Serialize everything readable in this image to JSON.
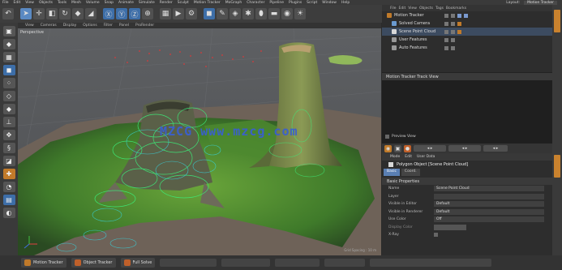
{
  "menubar": {
    "items": [
      "File",
      "Edit",
      "View",
      "Objects",
      "Tools",
      "Mesh",
      "Volume",
      "Snap",
      "Animate",
      "Simulate",
      "Render",
      "Sculpt",
      "Motion Tracker",
      "MoGraph",
      "Character",
      "Pipeline",
      "Plugins",
      "Script",
      "Window",
      "Help"
    ],
    "layout_label": "Layout:",
    "layout_value": "Motion Tracker"
  },
  "viewport": {
    "menu": [
      "View",
      "Cameras",
      "Display",
      "Options",
      "Filter",
      "Panel",
      "ProRender"
    ],
    "label": "Perspective",
    "watermark": "MZCG www.mzcg.com",
    "corner_text": "Grid Spacing : 10 m"
  },
  "object_manager": {
    "menu": [
      "File",
      "Edit",
      "View",
      "Objects",
      "Tags",
      "Bookmarks"
    ],
    "objects": [
      {
        "name": "Motion Tracker",
        "color": "#c07a2a"
      },
      {
        "name": "Solved Camera",
        "color": "#6a9ad0"
      },
      {
        "name": "Scene Point Cloud",
        "color": "#d8d8d8"
      },
      {
        "name": "User Features",
        "color": "#d8d8d8"
      },
      {
        "name": "Auto Features",
        "color": "#d8d8d8"
      }
    ]
  },
  "track_view": {
    "title": "Motion Tracker Track View",
    "preview_label": "Preview View"
  },
  "attributes": {
    "menu": [
      "Mode",
      "Edit",
      "User Data"
    ],
    "title": "Polygon Object [Scene Point Cloud]",
    "tabs": [
      "Basic",
      "Coord."
    ],
    "section": "Basic Properties",
    "props": [
      {
        "k": "Name",
        "v": "Scene Point Cloud"
      },
      {
        "k": "Layer",
        "v": ""
      },
      {
        "k": "Visible in Editor",
        "v": "Default"
      },
      {
        "k": "Visible in Renderer",
        "v": "Default"
      },
      {
        "k": "Use Color",
        "v": "Off"
      },
      {
        "k": "Display Color",
        "v": ""
      },
      {
        "k": "X-Ray",
        "v": ""
      }
    ]
  },
  "status": {
    "buttons": [
      {
        "label": "Motion Tracker",
        "color": "#c07a2a"
      },
      {
        "label": "Object Tracker",
        "color": "#c0602a"
      },
      {
        "label": "Full Solve",
        "color": "#c0602a"
      }
    ]
  }
}
